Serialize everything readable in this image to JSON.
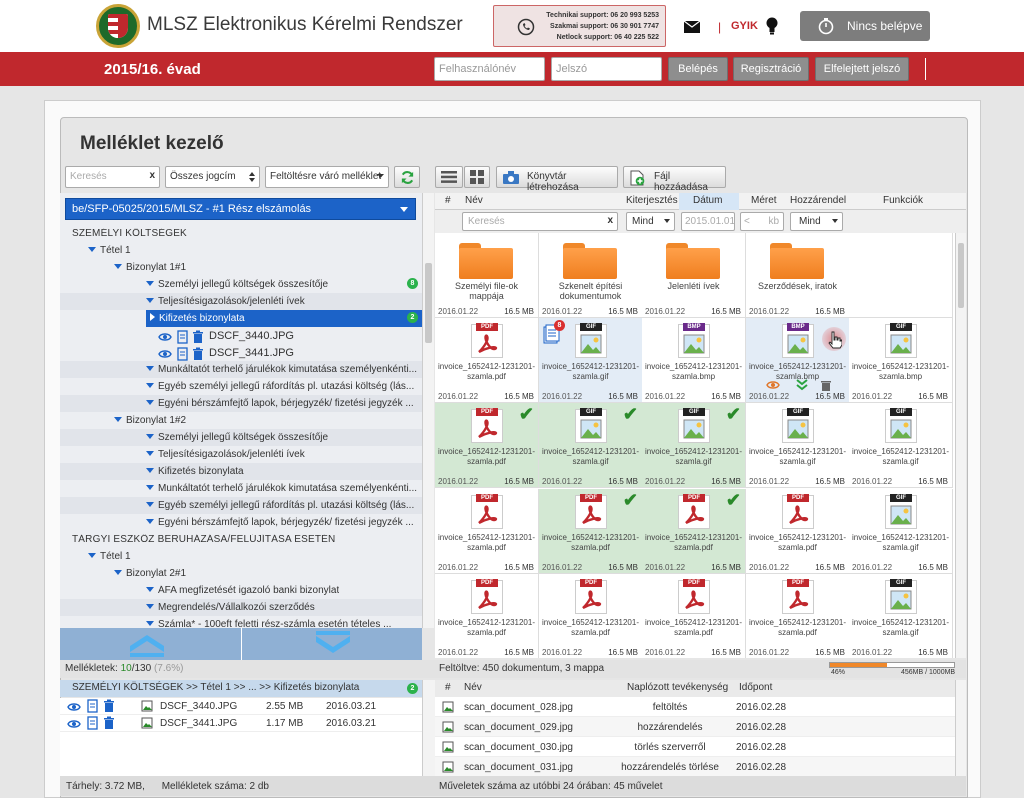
{
  "header": {
    "app_title": "MLSZ Elektronikus Kérelmi Rendszer",
    "support": [
      {
        "label": "Technikai support: 06 20 993 5253"
      },
      {
        "label": "Szakmai support: 06 30 901 7747"
      },
      {
        "label": "Netlock support: 06 40 225 522"
      }
    ],
    "faq_label": "GYIK",
    "login_status": "Nincs belépve"
  },
  "redbar": {
    "season": "2015/16. évad",
    "username_placeholder": "Felhasználónév",
    "password_placeholder": "Jelszó",
    "login_button": "Belépés",
    "register_button": "Regisztráció",
    "forgot_button": "Elfelejtett jelszó"
  },
  "panel": {
    "title": "Melléklet kezelő"
  },
  "left_toolbar": {
    "search_placeholder": "Keresés",
    "clear_glyph": "x",
    "filter_title": "Összes jogcím",
    "filter_status": "Feltöltésre váró melléklet"
  },
  "right_toolbar": {
    "new_folder": "Könyvtár létrehozása",
    "add_file": "Fájl hozzáadása"
  },
  "path_select": "be/SFP-05025/2015/MLSZ   -   #1 Rész elszámolás",
  "tree": [
    {
      "label": "SZEMÉLYI KÖLTSÉGEK",
      "type": "section"
    },
    {
      "label": "Tétel 1",
      "type": "node",
      "level": 1
    },
    {
      "label": "Bizonylat 1#1",
      "type": "node",
      "level": 2
    },
    {
      "label": "Személyi jellegű költségek összesítője",
      "type": "leaf",
      "badge": "8"
    },
    {
      "label": "Teljesítésigazolások/jelenléti ívek",
      "type": "leaf"
    },
    {
      "label": "Kifizetés bizonylata",
      "type": "selected",
      "badge": "2"
    },
    {
      "label": "DSCF_3440.JPG",
      "type": "file"
    },
    {
      "label": "DSCF_3441.JPG",
      "type": "file"
    },
    {
      "label": "Munkáltatót terhelő járulékok kimutatása személyenkénti...",
      "type": "leaf"
    },
    {
      "label": "Egyéb személyi jellegű ráfordítás pl. utazási költség (lás...",
      "type": "leaf"
    },
    {
      "label": "Egyéni bérszámfejtő lapok, bérjegyzék/ fizetési jegyzék ...",
      "type": "leaf"
    },
    {
      "label": "Bizonylat 1#2",
      "type": "node",
      "level": 2
    },
    {
      "label": "Személyi jellegű költségek összesítője",
      "type": "leaf"
    },
    {
      "label": "Teljesítésigazolások/jelenléti ívek",
      "type": "leaf"
    },
    {
      "label": "Kifizetés bizonylata",
      "type": "leaf"
    },
    {
      "label": "Munkáltatót terhelő járulékok kimutatása személyenkénti...",
      "type": "leaf"
    },
    {
      "label": "Egyéb személyi jellegű ráfordítás pl. utazási költség (lás...",
      "type": "leaf"
    },
    {
      "label": "Egyéni bérszámfejtő lapok, bérjegyzék/ fizetési jegyzék ...",
      "type": "leaf"
    },
    {
      "label": "TÁRGYI ESZKÖZ BERUHÁZÁSA/FELÚJÍTÁSA ESETÉN",
      "type": "section"
    },
    {
      "label": "Tétel 1",
      "type": "node",
      "level": 1
    },
    {
      "label": "Bizonylat 2#1",
      "type": "node",
      "level": 2
    },
    {
      "label": "ÁFA megfizetését igazoló banki bizonylat",
      "type": "leaf"
    },
    {
      "label": "Megrendelés/Vállalkozói szerződés",
      "type": "leaf"
    },
    {
      "label": "Számla* - 100eft feletti rész-számla esetén tételes ...",
      "type": "leaf"
    }
  ],
  "grid": {
    "columns": [
      "#",
      "Név",
      "Kiterjesztés",
      "Dátum",
      "Méret",
      "Hozzárendel",
      "Funkciók"
    ],
    "filters": {
      "name_placeholder": "Keresés",
      "ext": "Mind",
      "date": "2015.01.01",
      "size": "kb",
      "size_lt": "<",
      "assign": "Mind"
    },
    "rows": [
      [
        {
          "kind": "folder",
          "name": "Személyi file-ok mappája",
          "date": "2016.01.22",
          "size": "16.5 MB"
        },
        {
          "kind": "folder",
          "name": "Szkenelt építési dokumentumok",
          "date": "2016.01.22",
          "size": "16.5 MB"
        },
        {
          "kind": "folder",
          "name": "Jelenléti ívek",
          "date": "2016.01.22",
          "size": "16.5 MB"
        },
        {
          "kind": "folder",
          "name": "Szerződések, iratok",
          "date": "2016.01.22",
          "size": "16.5 MB"
        },
        {
          "kind": "empty"
        }
      ],
      [
        {
          "kind": "file",
          "type": "PDF",
          "name": "invoice_1652412-1231201-szamla.pdf",
          "date": "2016.01.22",
          "size": "16.5 MB"
        },
        {
          "kind": "file",
          "type": "GIF",
          "name": "invoice_1652412-1231201-szamla.gif",
          "date": "2016.01.22",
          "size": "16.5 MB",
          "state": "blue",
          "stack": "8"
        },
        {
          "kind": "file",
          "type": "BMP",
          "name": "invoice_1652412-1231201-szamla.bmp",
          "date": "2016.01.22",
          "size": "16.5 MB"
        },
        {
          "kind": "file",
          "type": "BMP",
          "name": "invoice_1652412-1231201-szamla.bmp",
          "date": "2016.01.22",
          "size": "16.5 MB",
          "state": "hover"
        },
        {
          "kind": "file",
          "type": "GIF",
          "name": "invoice_1652412-1231201-szamla.bmp",
          "date": "2016.01.22",
          "size": "16.5 MB"
        }
      ],
      [
        {
          "kind": "file",
          "type": "PDF",
          "name": "invoice_1652412-1231201-szamla.pdf",
          "date": "2016.01.22",
          "size": "16.5 MB",
          "state": "green"
        },
        {
          "kind": "file",
          "type": "GIF",
          "name": "invoice_1652412-1231201-szamla.gif",
          "date": "2016.01.22",
          "size": "16.5 MB",
          "state": "green"
        },
        {
          "kind": "file",
          "type": "GIF",
          "name": "invoice_1652412-1231201-szamla.gif",
          "date": "2016.01.22",
          "size": "16.5 MB",
          "state": "green"
        },
        {
          "kind": "file",
          "type": "GIF",
          "name": "invoice_1652412-1231201-szamla.gif",
          "date": "2016.01.22",
          "size": "16.5 MB"
        },
        {
          "kind": "file",
          "type": "GIF",
          "name": "invoice_1652412-1231201-szamla.gif",
          "date": "2016.01.22",
          "size": "16.5 MB"
        }
      ],
      [
        {
          "kind": "file",
          "type": "PDF",
          "name": "invoice_1652412-1231201-szamla.pdf",
          "date": "2016.01.22",
          "size": "16.5 MB"
        },
        {
          "kind": "file",
          "type": "PDF",
          "name": "invoice_1652412-1231201-szamla.pdf",
          "date": "2016.01.22",
          "size": "16.5 MB",
          "state": "green"
        },
        {
          "kind": "file",
          "type": "PDF",
          "name": "invoice_1652412-1231201-szamla.pdf",
          "date": "2016.01.22",
          "size": "16.5 MB",
          "state": "green"
        },
        {
          "kind": "file",
          "type": "PDF",
          "name": "invoice_1652412-1231201-szamla.pdf",
          "date": "2016.01.22",
          "size": "16.5 MB"
        },
        {
          "kind": "file",
          "type": "GIF",
          "name": "invoice_1652412-1231201-szamla.gif",
          "date": "2016.01.22",
          "size": "16.5 MB"
        }
      ],
      [
        {
          "kind": "file",
          "type": "PDF",
          "name": "invoice_1652412-1231201-szamla.pdf",
          "date": "2016.01.22",
          "size": "16.5 MB"
        },
        {
          "kind": "file",
          "type": "PDF",
          "name": "invoice_1652412-1231201-szamla.pdf",
          "date": "2016.01.22",
          "size": "16.5 MB"
        },
        {
          "kind": "file",
          "type": "PDF",
          "name": "invoice_1652412-1231201-szamla.pdf",
          "date": "2016.01.22",
          "size": "16.5 MB"
        },
        {
          "kind": "file",
          "type": "PDF",
          "name": "invoice_1652412-1231201-szamla.pdf",
          "date": "2016.01.22",
          "size": "16.5 MB"
        },
        {
          "kind": "file",
          "type": "GIF",
          "name": "invoice_1652412-1231201-szamla.gif",
          "date": "2016.01.22",
          "size": "16.5 MB"
        }
      ]
    ]
  },
  "left_status": {
    "label": "Mellékletek:",
    "done": "10",
    "total": "/130",
    "percent": "(7.6%)"
  },
  "right_status": {
    "label": "Feltöltve:",
    "value": "450 dokumentum, 3 mappa",
    "usage_percent": "46%",
    "usage_text": "456MB / 1000MB",
    "usage_fraction": 0.46
  },
  "breadcrumb": {
    "text": "SZEMÉLYI KÖLTSÉGEK  >> Tétel 1  >>  ...  >>  Kifizetés bizonylata",
    "badge": "2"
  },
  "attachments": [
    {
      "name": "DSCF_3440.JPG",
      "size": "2.55 MB",
      "date": "2016.03.21"
    },
    {
      "name": "DSCF_3441.JPG",
      "size": "1.17 MB",
      "date": "2016.03.21"
    }
  ],
  "log": {
    "columns": [
      "#",
      "Név",
      "Naplózott tevékenység",
      "Időpont"
    ],
    "rows": [
      {
        "name": "scan_document_028.jpg",
        "action": "feltöltés",
        "date": "2016.02.28"
      },
      {
        "name": "scan_document_029.jpg",
        "action": "hozzárendelés",
        "date": "2016.02.28"
      },
      {
        "name": "scan_document_030.jpg",
        "action": "törlés szerverről",
        "date": "2016.02.28"
      },
      {
        "name": "scan_document_031.jpg",
        "action": "hozzárendelés törlése",
        "date": "2016.02.28"
      }
    ]
  },
  "footer_left": {
    "storage_label": "Tárhely:",
    "storage_value": "3.72 MB,",
    "count_label": "Mellékletek száma:",
    "count_value": "2 db"
  },
  "footer_right": {
    "label": "Műveletek száma az utóbbi 24 órában:",
    "value": "45 művelet"
  },
  "colors": {
    "brand_red": "#c0282d",
    "selection_blue": "#1c63c8",
    "assigned_green": "#d3e8d3",
    "usage_orange": "#f0882a"
  }
}
